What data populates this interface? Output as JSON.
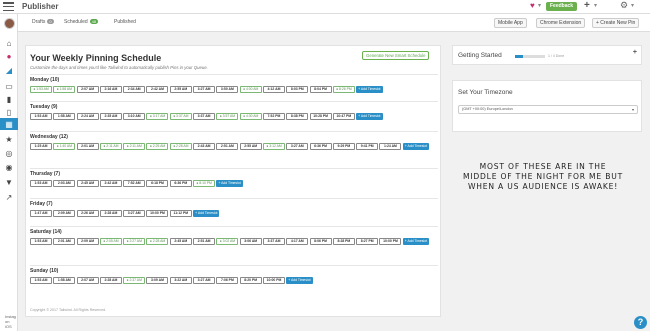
{
  "app": {
    "title": "Publisher"
  },
  "header": {
    "feedback_label": "Feedback",
    "plus_label": "+",
    "chevron": "▾",
    "heart": "♥",
    "gear": "⚙"
  },
  "sidebar": {
    "bottom_text_1": "Instag",
    "bottom_text_2": "on iOS"
  },
  "tabs": {
    "drafts_label": "Drafts",
    "drafts_count": "0",
    "scheduled_label": "Scheduled",
    "scheduled_count": "48",
    "published_label": "Published"
  },
  "toolbar": {
    "mobile_app": "Mobile App",
    "chrome_extension": "Chrome Extension",
    "create_new_pin": "+ Create New Pin",
    "chevron": "▾"
  },
  "schedule": {
    "title": "Your Weekly Pinning Schedule",
    "subtitle": "Customize the days and times you'd like Tailwind to automatically publish Pins in your Queue.",
    "generate_button": "Generate New Smart Schedule",
    "add_label": "+ Add Timeslot",
    "days": [
      {
        "label": "Monday (10)",
        "slots": [
          {
            "t": "● 1:53 AM",
            "p": true
          },
          {
            "t": "● 1:58 AM",
            "p": true
          },
          {
            "t": "2:07 AM",
            "p": false
          },
          {
            "t": "2:16 AM",
            "p": false
          },
          {
            "t": "2:34 AM",
            "p": false
          },
          {
            "t": "2:42 AM",
            "p": false
          },
          {
            "t": "2:55 AM",
            "p": false
          },
          {
            "t": "3:27 AM",
            "p": false
          },
          {
            "t": "3:50 AM",
            "p": false
          },
          {
            "t": "● 4:00 AM",
            "p": true
          },
          {
            "t": "4:12 AM",
            "p": false
          },
          {
            "t": "8:03 PM",
            "p": false
          },
          {
            "t": "8:04 PM",
            "p": false
          },
          {
            "t": "● 8:26 PM",
            "p": true
          }
        ]
      },
      {
        "label": "Tuesday (9)",
        "slots": [
          {
            "t": "1:53 AM",
            "p": false
          },
          {
            "t": "1:58 AM",
            "p": false
          },
          {
            "t": "2:24 AM",
            "p": false
          },
          {
            "t": "2:35 AM",
            "p": false
          },
          {
            "t": "3:10 AM",
            "p": false
          },
          {
            "t": "● 3:17 AM",
            "p": true
          },
          {
            "t": "● 3:37 AM",
            "p": true
          },
          {
            "t": "3:37 AM",
            "p": false
          },
          {
            "t": "● 3:57 AM",
            "p": true
          },
          {
            "t": "● 4:30 AM",
            "p": true
          },
          {
            "t": "7:52 PM",
            "p": false
          },
          {
            "t": "8:38 PM",
            "p": false
          },
          {
            "t": "10:28 PM",
            "p": false
          },
          {
            "t": "10:47 PM",
            "p": false
          }
        ]
      },
      {
        "label": "Wednesday (12)",
        "slots": [
          {
            "t": "1:25 AM",
            "p": false
          },
          {
            "t": "● 1:40 AM",
            "p": true
          },
          {
            "t": "2:01 AM",
            "p": false
          },
          {
            "t": "● 2:11 AM",
            "p": true
          },
          {
            "t": "● 2:11 AM",
            "p": true
          },
          {
            "t": "● 2:25 AM",
            "p": true
          },
          {
            "t": "● 2:28 AM",
            "p": true
          },
          {
            "t": "2:43 AM",
            "p": false
          },
          {
            "t": "2:51 AM",
            "p": false
          },
          {
            "t": "2:55 AM",
            "p": false
          },
          {
            "t": "● 3:12 AM",
            "p": true
          },
          {
            "t": "3:27 AM",
            "p": false
          },
          {
            "t": "6:36 PM",
            "p": false
          },
          {
            "t": "9:29 PM",
            "p": false
          },
          {
            "t": "9:41 PM",
            "p": false
          },
          {
            "t": "1:24 AM",
            "p": false
          }
        ]
      },
      {
        "label": "Thursday (7)",
        "slots": [
          {
            "t": "1:53 AM",
            "p": false
          },
          {
            "t": "2:03 AM",
            "p": false
          },
          {
            "t": "2:45 AM",
            "p": false
          },
          {
            "t": "2:42 AM",
            "p": false
          },
          {
            "t": "7:52 AM",
            "p": false
          },
          {
            "t": "6:18 PM",
            "p": false
          },
          {
            "t": "6:36 PM",
            "p": false
          },
          {
            "t": "● 8:10 PM",
            "p": true
          }
        ]
      },
      {
        "label": "Friday (7)",
        "slots": [
          {
            "t": "1:47 AM",
            "p": false
          },
          {
            "t": "2:09 AM",
            "p": false
          },
          {
            "t": "2:26 AM",
            "p": false
          },
          {
            "t": "2:28 AM",
            "p": false
          },
          {
            "t": "3:27 AM",
            "p": false
          },
          {
            "t": "10:00 PM",
            "p": false
          },
          {
            "t": "11:12 PM",
            "p": false
          }
        ]
      },
      {
        "label": "Saturday (14)",
        "slots": [
          {
            "t": "1:53 AM",
            "p": false
          },
          {
            "t": "2:01 AM",
            "p": false
          },
          {
            "t": "2:09 AM",
            "p": false
          },
          {
            "t": "● 2:05 AM",
            "p": true
          },
          {
            "t": "● 2:27 AM",
            "p": true
          },
          {
            "t": "● 2:28 AM",
            "p": true
          },
          {
            "t": "2:45 AM",
            "p": false
          },
          {
            "t": "2:51 AM",
            "p": false
          },
          {
            "t": "● 3:02 AM",
            "p": true
          },
          {
            "t": "3:06 AM",
            "p": false
          },
          {
            "t": "3:37 AM",
            "p": false
          },
          {
            "t": "4:17 AM",
            "p": false
          },
          {
            "t": "8:06 PM",
            "p": false
          },
          {
            "t": "8:28 PM",
            "p": false
          },
          {
            "t": "8:27 PM",
            "p": false
          },
          {
            "t": "10:00 PM",
            "p": false
          }
        ]
      },
      {
        "label": "Sunday (10)",
        "slots": [
          {
            "t": "1:53 AM",
            "p": false
          },
          {
            "t": "1:58 AM",
            "p": false
          },
          {
            "t": "2:07 AM",
            "p": false
          },
          {
            "t": "2:28 AM",
            "p": false
          },
          {
            "t": "● 2:37 AM",
            "p": true
          },
          {
            "t": "3:09 AM",
            "p": false
          },
          {
            "t": "3:22 AM",
            "p": false
          },
          {
            "t": "3:27 AM",
            "p": false
          },
          {
            "t": "7:06 PM",
            "p": false
          },
          {
            "t": "8:20 PM",
            "p": false
          },
          {
            "t": "10:00 PM",
            "p": false
          }
        ]
      }
    ],
    "copyright": "Copyright © 2017 Tailwind. All Rights Reserved."
  },
  "getting_started": {
    "title": "Getting Started",
    "progress_text": "1 / 4 Done",
    "progress_fraction": 0.25
  },
  "timezone": {
    "title": "Set Your Timezone",
    "value": "(GMT +00:00) Europe/London",
    "caret": "▾"
  },
  "overlay": {
    "text": "MOST OF THESE ARE IN THE MIDDLE OF THE NIGHT FOR ME BUT WHEN A US AUDIENCE IS AWAKE!"
  },
  "help": {
    "label": "?"
  },
  "colors": {
    "accent": "#2a8fc6",
    "success": "#5aa84d",
    "pin_red": "#c22e6e"
  }
}
